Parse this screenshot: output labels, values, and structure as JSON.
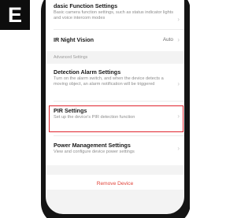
{
  "step_badge": "E",
  "settings": {
    "basic": {
      "title": "dasic Function Settings",
      "desc": "Basic camera function settings, such as status indicator lights and voice intercom modes"
    },
    "ir_night_vision": {
      "title": "IR Night Vision",
      "value": "Auto"
    },
    "advanced_section_label": "Advanced Settings",
    "detection_alarm": {
      "title": "Detection Alarm Settings",
      "desc": "Turn on the alarm switch, and when the device detects a moving object, an alarm notification will be triggered"
    },
    "pir": {
      "title": "PIR Settings",
      "desc": "Set up the device's PIR detection function"
    },
    "power_management": {
      "title": "Power Management Settings",
      "desc": "View and configure device power settings"
    },
    "remove_device_label": "Remove Device"
  },
  "icons": {
    "chevron": "chevron-right-icon"
  },
  "colors": {
    "highlight": "#e0262f",
    "remove_text": "#e0443b",
    "badge_bg": "#0d0d0d"
  }
}
